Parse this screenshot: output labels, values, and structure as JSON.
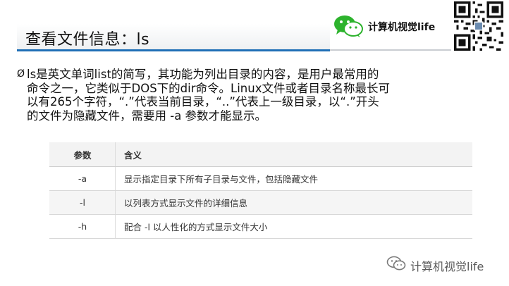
{
  "header": {
    "title": "查看文件信息：ls",
    "brand": "计算机视觉life"
  },
  "content": {
    "bullet": "Ø",
    "lines": [
      "ls是英文单词list的简写，其功能为列出目录的内容，是用户最常用的",
      "命令之一，它类似于DOS下的dir命令。Linux文件或者目录名称最长可",
      "以有265个字符，“.”代表当前目录，“..”代表上一级目录，以“.”开头",
      "的文件为隐藏文件，需要用 -a 参数才能显示。"
    ]
  },
  "table": {
    "headers": [
      "参数",
      "含义"
    ],
    "rows": [
      {
        "param": "-a",
        "meaning": "显示指定目录下所有子目录与文件，包括隐藏文件"
      },
      {
        "param": "-l",
        "meaning": "以列表方式显示文件的详细信息"
      },
      {
        "param": "-h",
        "meaning": "配合 -l 以人性化的方式显示文件大小"
      }
    ]
  },
  "footer": {
    "watermark": "计算机视觉life"
  },
  "colors": {
    "accent_rule": "#1f6fb6",
    "wechat_green": "#2db32d",
    "row_shade": "#f5f5f5"
  },
  "icons": {
    "brand": "wechat-icon",
    "qr": "qr-code",
    "watermark": "wechat-icon"
  }
}
